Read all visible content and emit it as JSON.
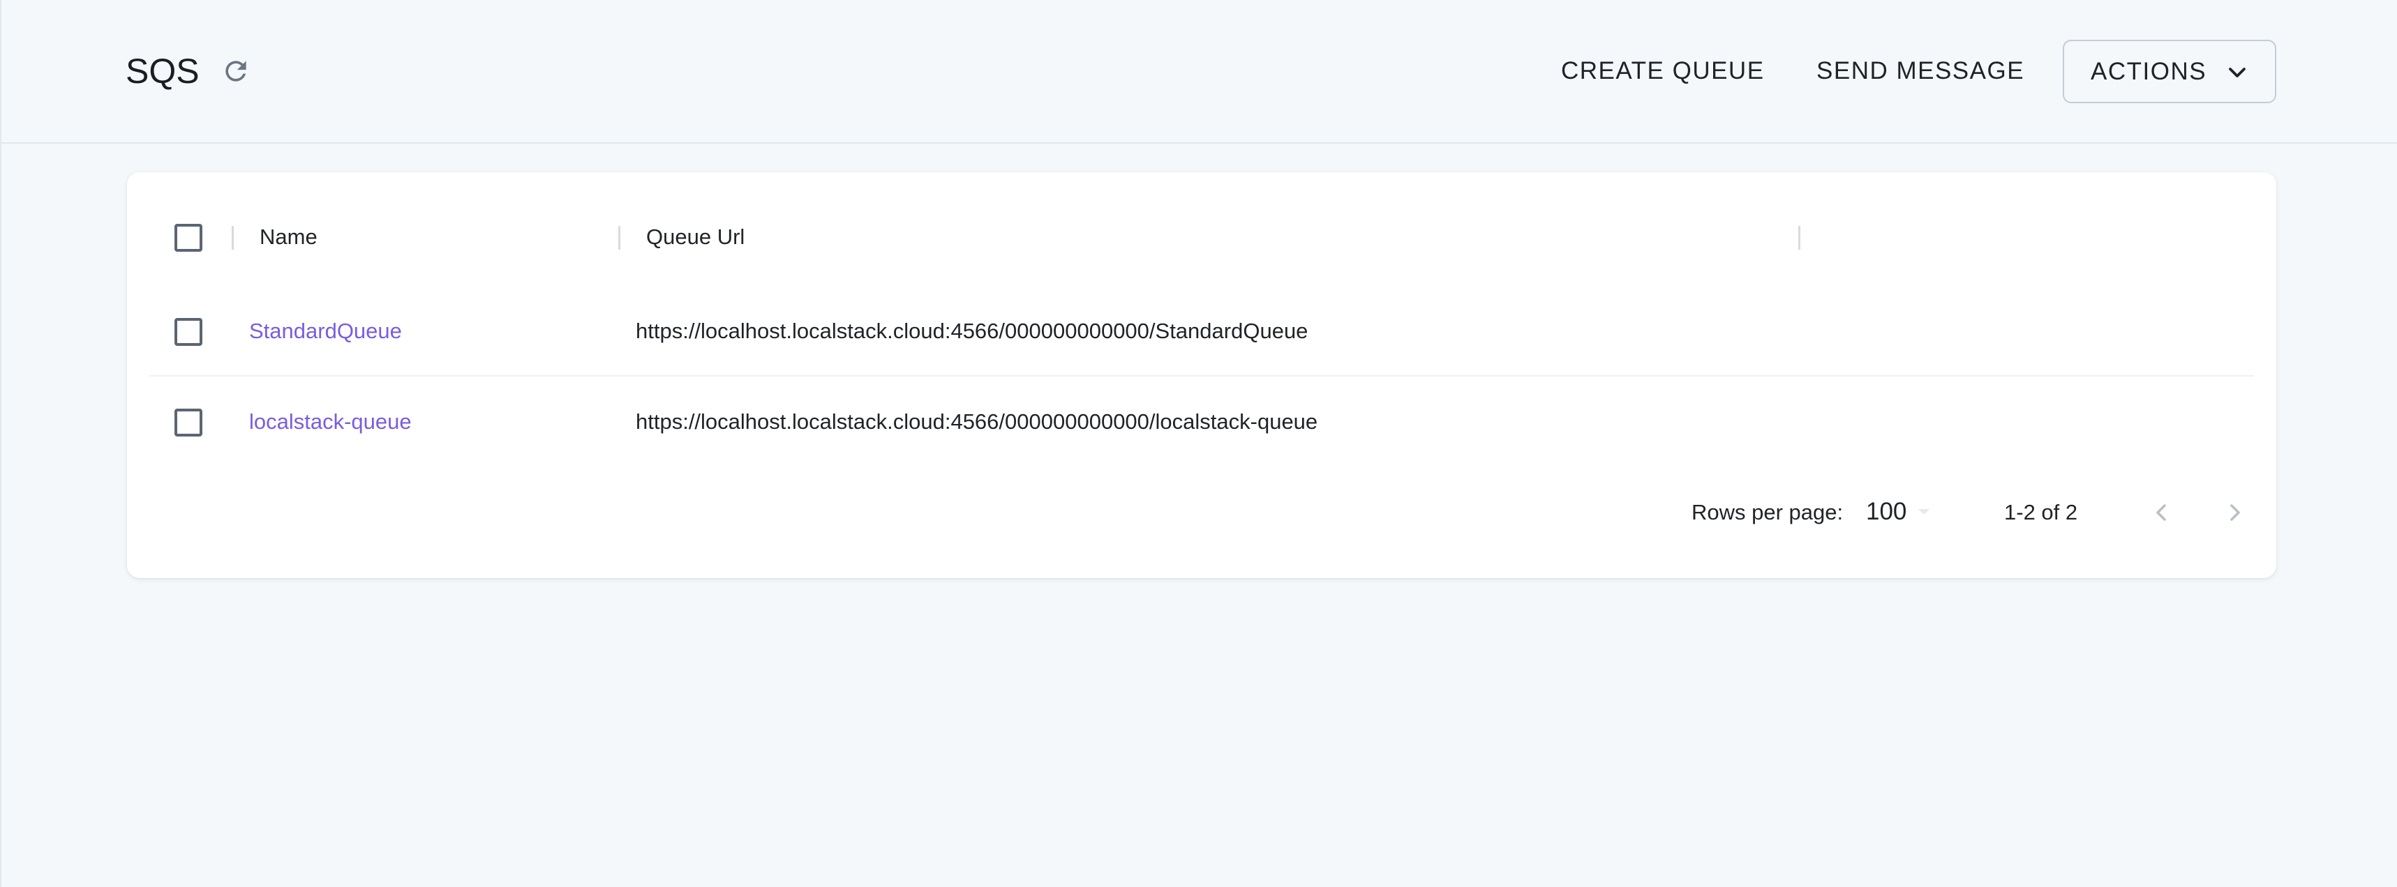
{
  "header": {
    "title": "SQS",
    "create_queue_label": "CREATE QUEUE",
    "send_message_label": "SEND MESSAGE",
    "actions_label": "ACTIONS"
  },
  "table": {
    "columns": [
      "Name",
      "Queue Url"
    ],
    "rows": [
      {
        "name": "StandardQueue",
        "url": "https://localhost.localstack.cloud:4566/000000000000/StandardQueue"
      },
      {
        "name": "localstack-queue",
        "url": "https://localhost.localstack.cloud:4566/000000000000/localstack-queue"
      }
    ]
  },
  "pagination": {
    "rows_per_page_label": "Rows per page:",
    "rows_per_page_value": "100",
    "range_label": "1-2 of 2"
  },
  "colors": {
    "link": "#7a5ce0",
    "background": "#f5f8fb",
    "checkbox_border": "#5b6573"
  },
  "icons": {
    "refresh": "refresh-icon",
    "actions_dropdown": "chevron-down-icon",
    "prev_page": "chevron-left-icon",
    "next_page": "chevron-right-icon"
  }
}
